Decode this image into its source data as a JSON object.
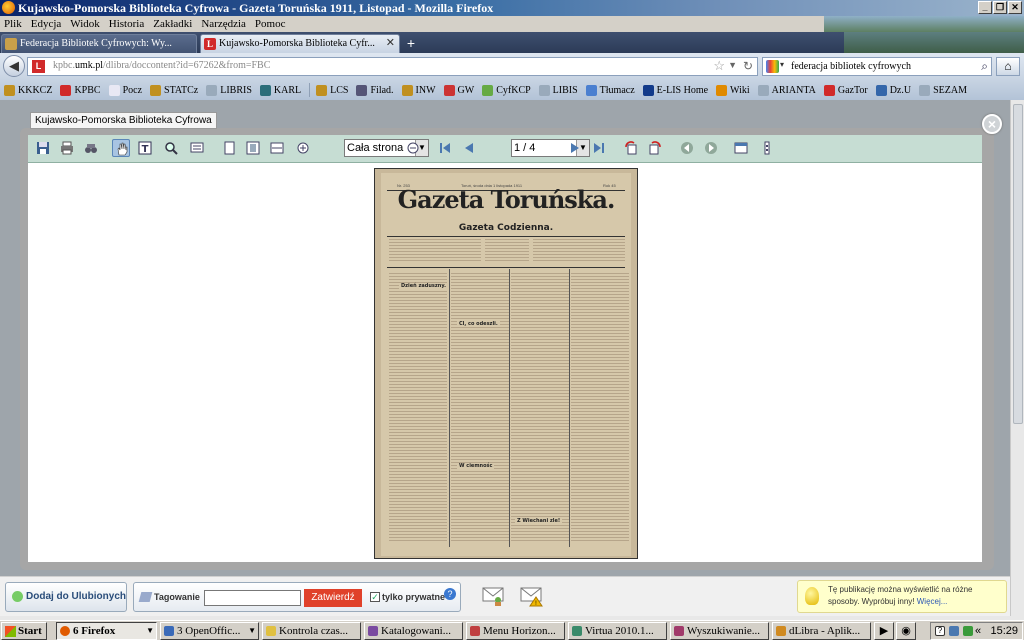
{
  "window": {
    "title": "Kujawsko-Pomorska Biblioteka Cyfrowa - Gazeta Toruńska 1911, Listopad - Mozilla Firefox",
    "controls": [
      "_",
      "❐",
      "✕"
    ]
  },
  "menu": [
    "Plik",
    "Edycja",
    "Widok",
    "Historia",
    "Zakładki",
    "Narzędzia",
    "Pomoc"
  ],
  "tabs": [
    {
      "label": "Federacja Bibliotek Cyfrowych: Wy...",
      "active": false
    },
    {
      "label": "Kujawsko-Pomorska Biblioteka Cyfr...",
      "active": true
    }
  ],
  "nav": {
    "url_prefix": "kpbc.",
    "url_domain": "umk.pl",
    "url_rest": "/dlibra/doccontent?id=67262&from=FBC",
    "search_query": "federacja bibliotek cyfrowych"
  },
  "bookmarks": [
    "KKKCZ",
    "KPBC",
    "Pocz",
    "STATCz",
    "LIBRIS",
    "KARL",
    "LCS",
    "Filad.",
    "INW",
    "GW",
    "CyfKCP",
    "LIBIS",
    "Tłumacz",
    "E-LIS Home",
    "Wiki",
    "ARIANTA",
    "GazTor",
    "Dz.U",
    "SEZAM"
  ],
  "lightbox": {
    "label": "Kujawsko-Pomorska Biblioteka Cyfrowa",
    "zoom_value": "Cała strona",
    "page_value": "1 / 4"
  },
  "newspaper": {
    "title": "Gazeta Toruńska.",
    "subtitle": "Gazeta Codzienna.",
    "issue": "Nr. 253",
    "dateline": "Toruń, środa dnia 1 listopada 1911",
    "year": "Rok 45",
    "headline1": "Dzień zaduszny.",
    "headline2": "Cl, co odeszli.",
    "headline3": "W ciemnośc",
    "headline4": "Z Wiechani zle!"
  },
  "bottom": {
    "favorites_button": "Dodaj do Ulubionych",
    "tag_label": "Tagowanie",
    "confirm_button": "Zatwierdź",
    "private_label": "tylko prywatne",
    "tip_text": "Tę publikację można wyświetlić na różne sposoby. Wypróbuj inny!",
    "tip_more": "Więcej..."
  },
  "taskbar": {
    "start": "Start",
    "tasks": [
      "6 Firefox",
      "3 OpenOffic...",
      "Kontrola czas...",
      "Katalogowani...",
      "Menu Horizon...",
      "Virtua 2010.1...",
      "Wyszukiwanie...",
      "dLibra - Aplik..."
    ],
    "clock": "15:29"
  }
}
